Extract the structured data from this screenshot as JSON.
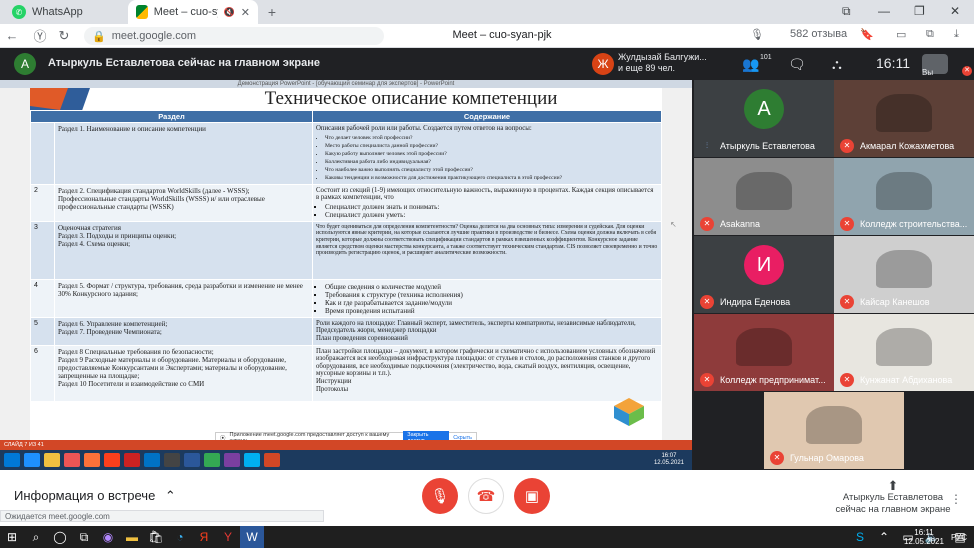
{
  "browser": {
    "tabs": [
      {
        "label": "WhatsApp"
      },
      {
        "label": "Meet – cuo-syan-pjk"
      }
    ],
    "url": "meet.google.com",
    "page_title": "Meet – cuo-syan-pjk",
    "reviews": "582 отзыва",
    "window_user": "Вы"
  },
  "meet": {
    "presenter_banner": "Атыркуль Еставлетова сейчас на главном экране",
    "presenter_initial": "А",
    "others_initial": "Ж",
    "others_line1": "Жулдызай Балгужи...",
    "others_line2": "и еще 89 чел.",
    "participants_count": "101",
    "clock": "16:11"
  },
  "slide": {
    "ppt_caption": "Демонстрация PowerPoint - [обучающий семинар для экспертов] - PowerPoint",
    "title": "Техническое описание компетенции",
    "col_section": "Раздел",
    "col_content": "Содержание",
    "rows": [
      {
        "num": "",
        "section": "Раздел 1. Наименование и описание компетенции",
        "intro": "Описания рабочей роли или работы. Создается путем ответов на вопросы:",
        "bullets": [
          "Что делает человек этой профессии?",
          "Место работы специалиста данной профессии?",
          "Какую работу выполняет человек этой профессии?",
          "Коллективная работа либо индивидуальная?",
          "Что наиболее важно выполнять специалисту этой профессии?",
          "Каковы тенденции и возможности для достижения практикующего специалиста в этой профессии?"
        ],
        "tail": ""
      },
      {
        "num": "2",
        "section": "Раздел 2. Спецификация стандартов WorldSkills (далее - WSSS); Профессиональные стандарты WorldSkills (WSSS) и/ или отраслевые профессиональные стандарты (WSSK)",
        "intro": "Состоит из секций (1-9) имеющих относительную важность, выраженную в процентах. Каждая секция описывается в рамках компетенции, что",
        "bullets": [
          "Специалист должен знать и понимать:",
          "Специалист должен уметь:"
        ],
        "tail": ""
      },
      {
        "num": "3",
        "section": "Оценочная стратегия\nРаздел 3. Подходы и принципы оценки;\nРаздел 4. Схема оценки;",
        "intro": "Что будет оцениваться для определения компетентности? Оценка делится на два основных типа: измерения и судейская. Для оценки используются явные критерии, на которые ссылаются лучшие практики в производстве и бизнесе. Схема оценки должна включать в себя критерии, которые должны соответствовать спецификации стандартов в рамках взвешенных коэффициентов. Конкурсное задание является средством оценки мастерства конкурсанта, а также соответствует техническим стандартам. CIS позволяет своевременно и точно производить регистрацию оценок, и расширяет аналитические возможности.",
        "bullets": [],
        "tail": ""
      },
      {
        "num": "4",
        "section": "Раздел 5. Формат / структура, требования, среда разработки и изменение не менее 30% Конкурсного задания;",
        "intro": "",
        "bullets": [
          "Общие сведения о количестве модулей",
          "Требования к структуре (техника исполнения)",
          "Как и где разрабатывается задание/модули",
          "Время проведения испытаний"
        ],
        "tail": ""
      },
      {
        "num": "5",
        "section": "Раздел 6. Управление компетенцией;\nРаздел 7. Проведение Чемпионата;",
        "intro": "Роли каждого на площадке: Главный эксперт, заместитель, эксперты компатриоты, независимые наблюдатели, Председатель жюри, менеджер площадки\nПлан проведения соревнований",
        "bullets": [],
        "tail": ""
      },
      {
        "num": "6",
        "section": "Раздел 8 Специальные требования по безопасности;\nРаздел 9 Расходные материалы и оборудование. Материалы и оборудование, предоставляемые Конкурсантами и Экспертами; материалы и оборудование, запрещенные на площадке;\nРаздел 10 Посетители и взаимодействие со СМИ",
        "intro": "План застройки площадки – документ, в котором графически и схематично с использованием условных обозначений изображается вся необходимая инфраструктура площадки: от стульев и столов, до расположения станков и другого оборудования, все необходимые подключения (электричество, вода, сжатый воздух, вентиляция, освещение, мусорные корзины и т.п.).\nИнструкции\nПротоколы",
        "bullets": [],
        "tail": ""
      }
    ],
    "notif_text": "Приложение meet.google.com предоставляет доступ к вашему экрану.",
    "notif_accept": "Закрыть доступ",
    "notif_hide": "Скрыть",
    "status": "СЛАЙД 7 ИЗ 41"
  },
  "participants": [
    {
      "name": "Атыркуль Еставлетова",
      "initial": "А",
      "color": "#2e7d32",
      "muted": false
    },
    {
      "name": "Акмарал Кожахметова",
      "initial": "",
      "color": "#5d4037",
      "muted": true
    },
    {
      "name": "Asakanna",
      "initial": "",
      "color": "#8d8d8d",
      "muted": true
    },
    {
      "name": "Колледж строительства...",
      "initial": "",
      "color": "#90a4ae",
      "muted": true
    },
    {
      "name": "Индира Еденова",
      "initial": "И",
      "color": "#e91e63",
      "muted": true
    },
    {
      "name": "Кайсар Канешов",
      "initial": "",
      "color": "#cfcfcf",
      "muted": true
    },
    {
      "name": "Колледж предпринимат...",
      "initial": "",
      "color": "#8e3b3b",
      "muted": true
    },
    {
      "name": "Кунжанат Абдиханова",
      "initial": "",
      "color": "#e8e6e0",
      "muted": true
    },
    {
      "name": "Гульнар Омарова",
      "initial": "",
      "color": "#e0c8b0",
      "muted": true
    }
  ],
  "bottom": {
    "info_label": "Информация о встрече",
    "presenting_line1": "Атыркуль Еставлетова",
    "presenting_line2": "сейчас на главном экране",
    "status_url": "Ожидается meet.google.com"
  },
  "taskbar": {
    "time": "16:11",
    "date": "12.05.2021",
    "lang": "РУС",
    "ppt_time": "16:07",
    "ppt_date": "12.05.2021"
  }
}
